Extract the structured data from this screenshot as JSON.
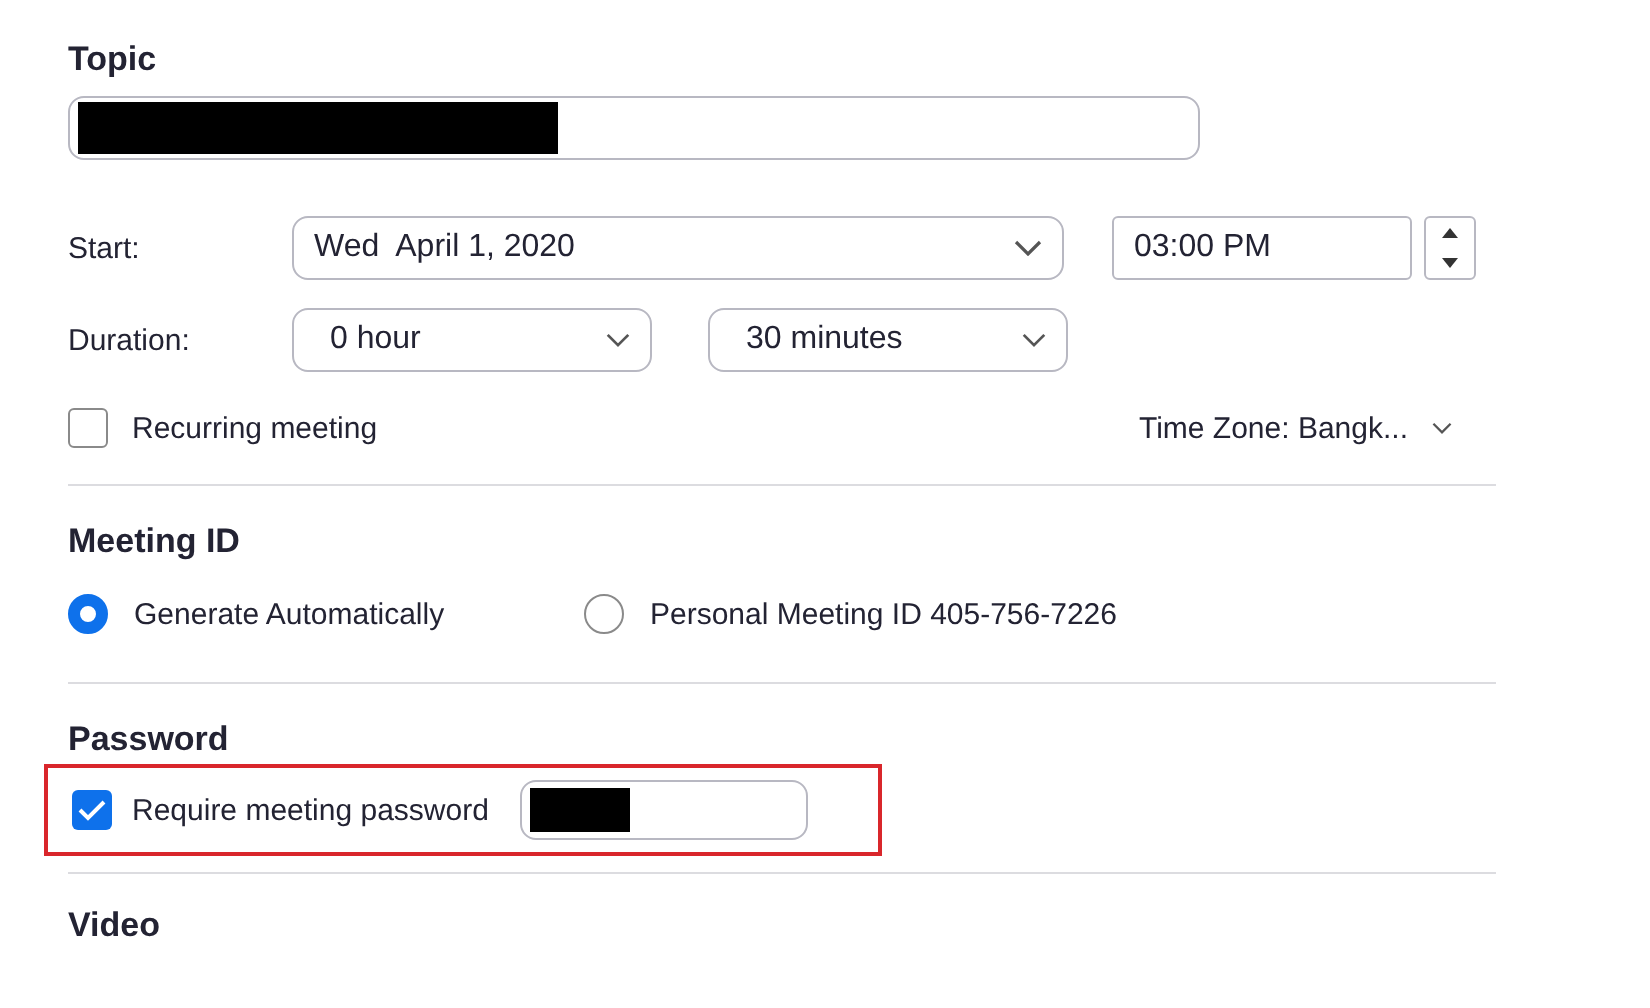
{
  "topic": {
    "label": "Topic",
    "redacted": true
  },
  "start": {
    "label": "Start:",
    "date": "Wed  April 1, 2020",
    "time": "03:00 PM"
  },
  "duration": {
    "label": "Duration:",
    "hours": "0 hour",
    "minutes": "30 minutes"
  },
  "recurring": {
    "label": "Recurring meeting",
    "checked": false
  },
  "time_zone": "Time Zone: Bangk...",
  "meeting_id": {
    "title": "Meeting ID",
    "options": [
      {
        "label": "Generate Automatically",
        "selected": true
      },
      {
        "label": "Personal Meeting ID 405-756-7226",
        "selected": false
      }
    ]
  },
  "password": {
    "title": "Password",
    "label": "Require meeting password",
    "checked": true,
    "redacted": true,
    "highlighted": true
  },
  "video": {
    "title": "Video"
  }
}
